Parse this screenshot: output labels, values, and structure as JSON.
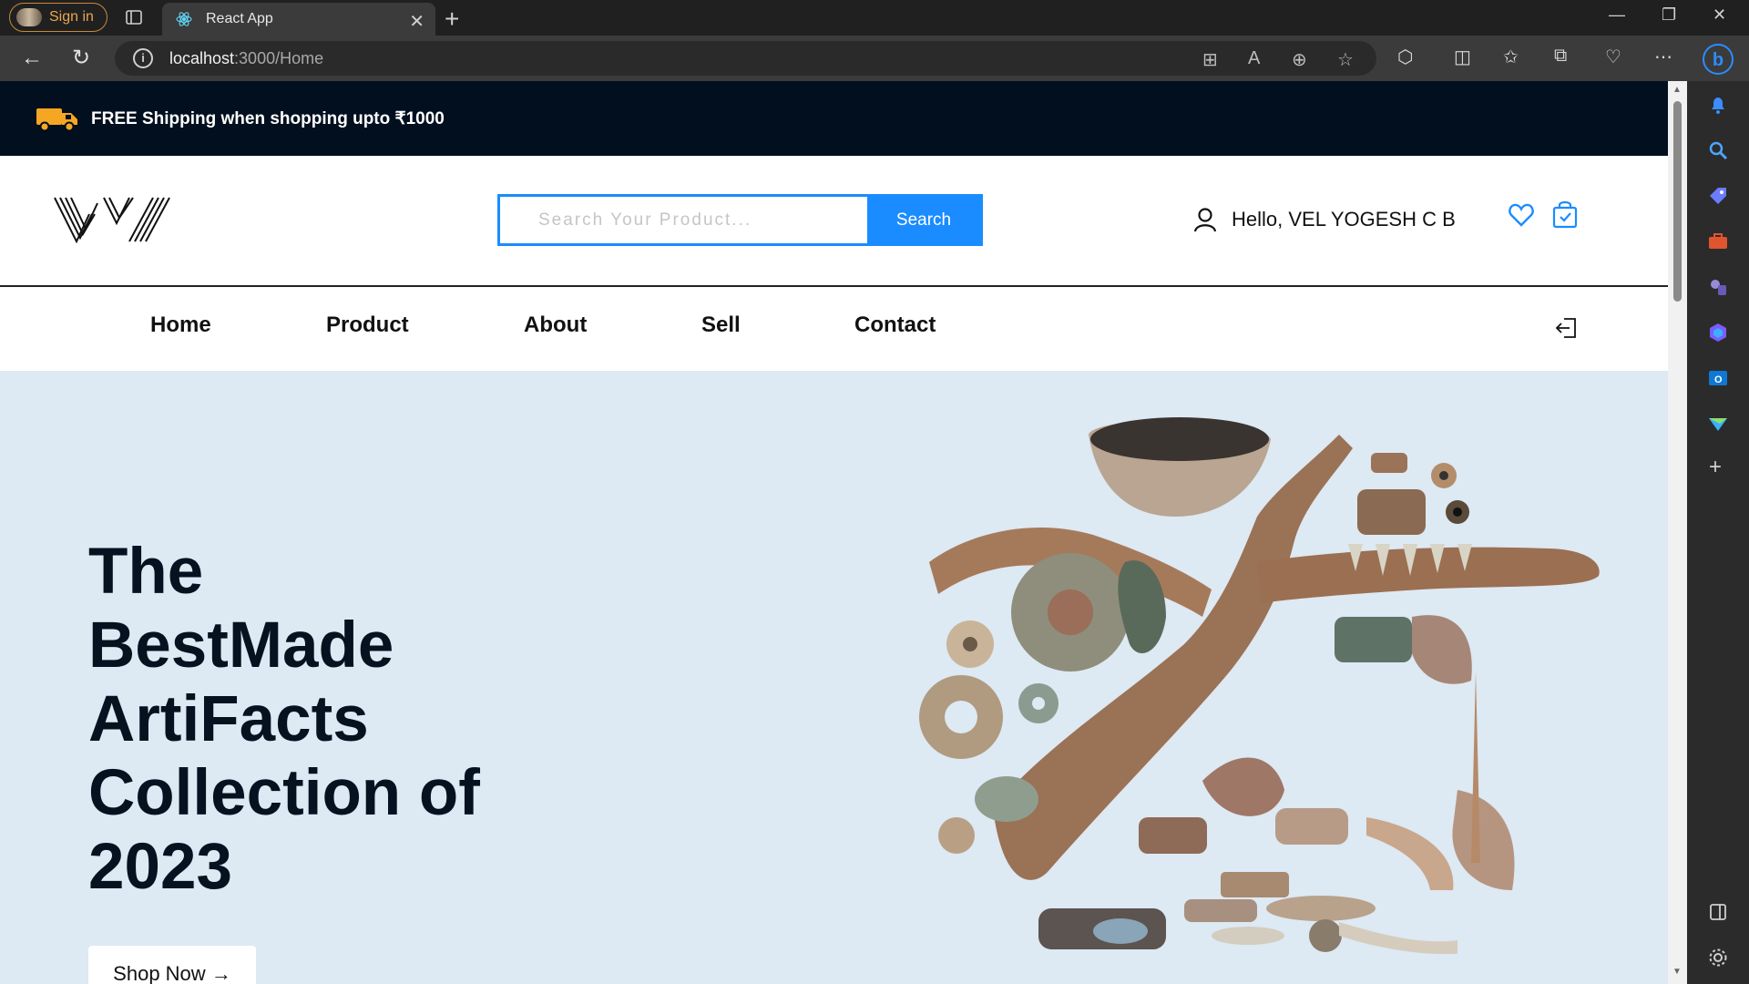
{
  "browser": {
    "signin_label": "Sign in",
    "tab_title": "React App",
    "url_host": "localhost",
    "url_path": ":3000/Home",
    "read_aloud_label": "A"
  },
  "promo": {
    "text": "FREE Shipping when shopping upto ₹1000",
    "truck_color": "#f5a623"
  },
  "header": {
    "logo_text": "VY",
    "search_placeholder": "Search Your Product...",
    "search_button": "Search",
    "greeting": "Hello, VEL YOGESH C B"
  },
  "nav": {
    "items": [
      "Home",
      "Product",
      "About",
      "Sell",
      "Contact"
    ]
  },
  "hero": {
    "title_lines": [
      "The",
      "BestMade",
      "ArtiFacts",
      "Collection of",
      "2023"
    ],
    "cta_label": "Shop Now",
    "cta_arrow": "→",
    "background": "#dde9f3"
  },
  "colors": {
    "accent": "#1a8cff",
    "promo_bg": "#020f1e"
  }
}
